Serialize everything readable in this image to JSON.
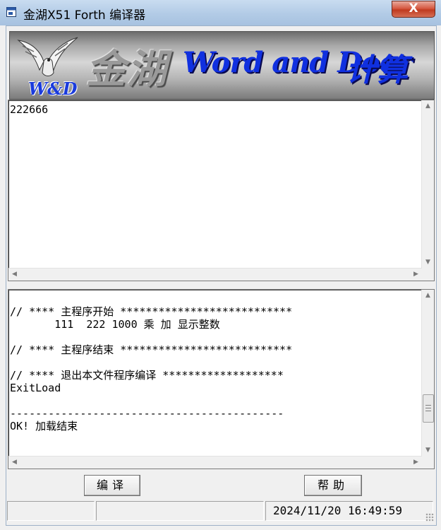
{
  "window": {
    "title": "金湖X51 Forth 编译器",
    "close_glyph": "X"
  },
  "banner": {
    "logo_text": "W&D",
    "chinese_brand": "金湖",
    "english_brand": "Word and Door",
    "chinese_suffix": "计算机"
  },
  "output_panel": {
    "text": "222666"
  },
  "source_panel": {
    "text": "\n// **** 主程序开始 ***************************\n       111  222 1000 乘 加 显示整数\n\n// **** 主程序结束 ***************************\n\n// **** 退出本文件程序编译 *******************\nExitLoad\n\n-------------------------------------------\nOK! 加载结束"
  },
  "buttons": {
    "compile_label": "编译",
    "help_label": "帮助"
  },
  "status": {
    "panel1": "",
    "panel2": "",
    "datetime": "2024/11/20 16:49:59"
  },
  "colors": {
    "titlebar": "#b2cbe6",
    "close_button": "#c8432b",
    "banner_blue": "#1030e0"
  },
  "icons": {
    "app": "app-window-icon",
    "close": "close-icon",
    "scroll_up": "triangle-up",
    "scroll_down": "triangle-down",
    "scroll_left": "triangle-left",
    "scroll_right": "triangle-right"
  }
}
